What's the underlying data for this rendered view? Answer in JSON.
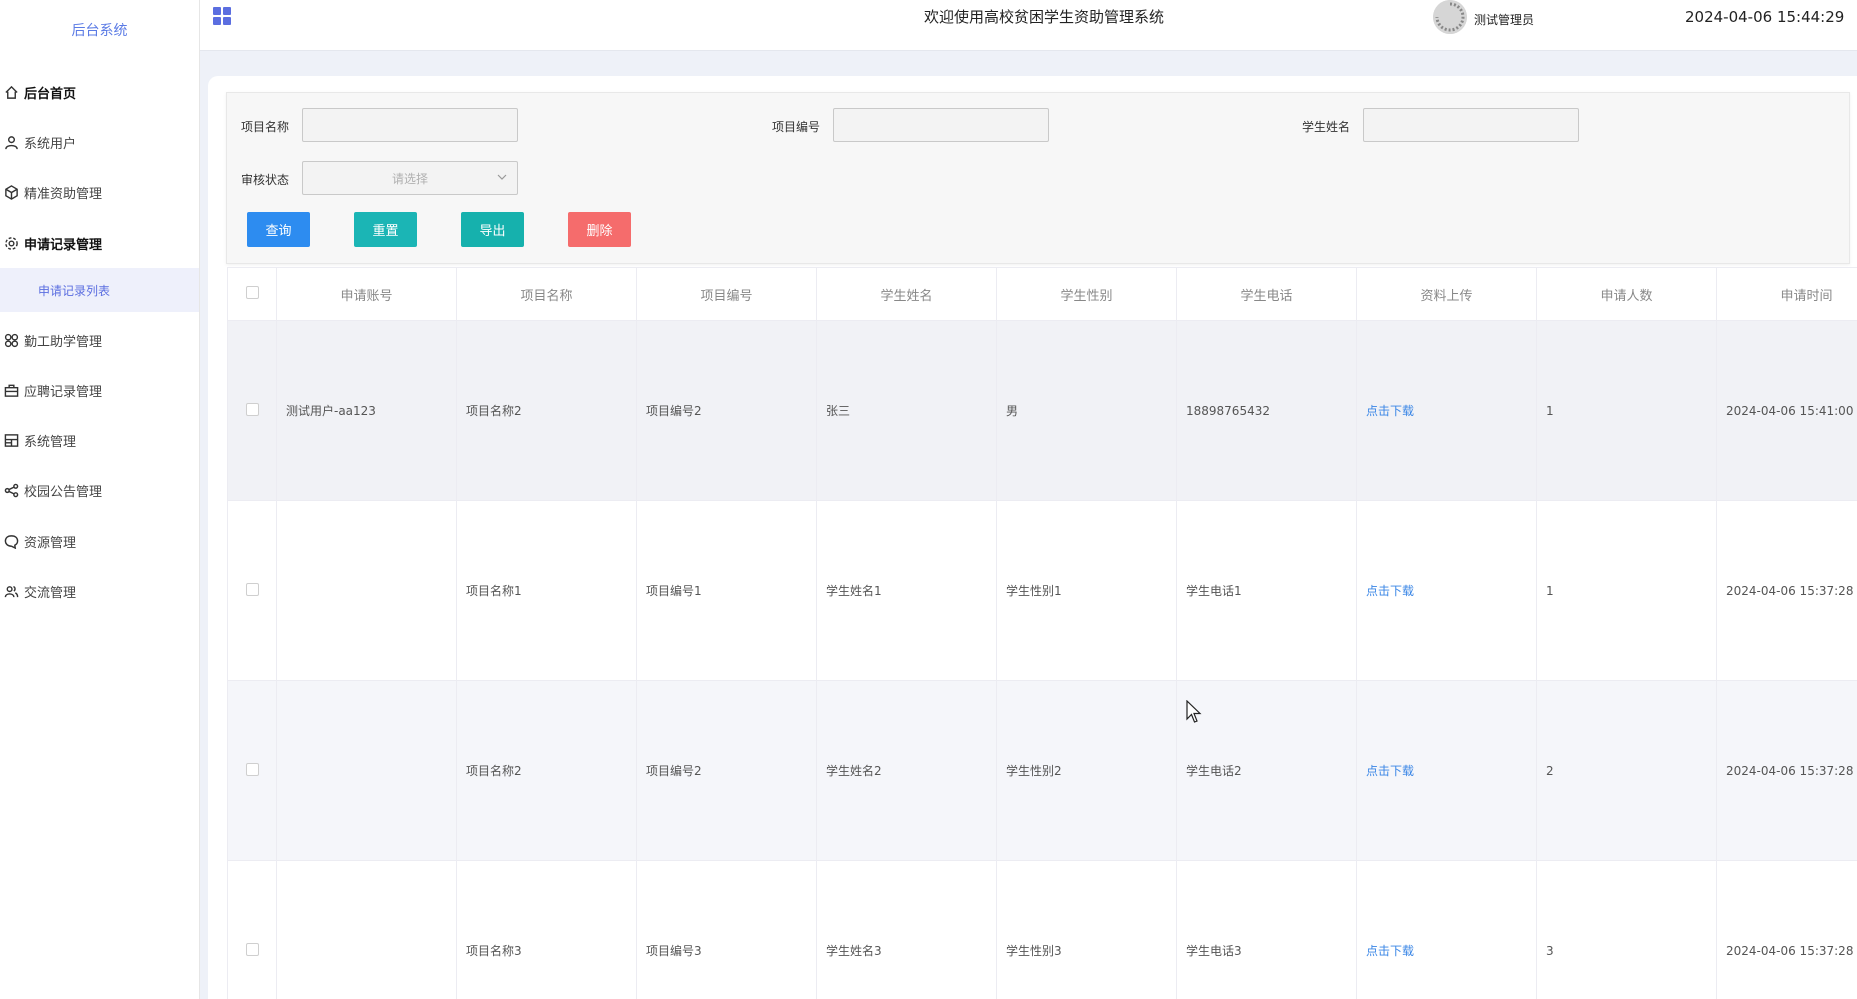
{
  "sidebar": {
    "brand": "后台系统",
    "items": [
      {
        "label": "后台首页",
        "icon": "home-icon"
      },
      {
        "label": "系统用户",
        "icon": "user-icon"
      },
      {
        "label": "精准资助管理",
        "icon": "cube-icon"
      },
      {
        "label": "申请记录管理",
        "icon": "gear-icon"
      },
      {
        "label": "勤工助学管理",
        "icon": "grid-icon"
      },
      {
        "label": "应聘记录管理",
        "icon": "briefcase-icon"
      },
      {
        "label": "系统管理",
        "icon": "layout-icon"
      },
      {
        "label": "校园公告管理",
        "icon": "share-icon"
      },
      {
        "label": "资源管理",
        "icon": "chat-icon"
      },
      {
        "label": "交流管理",
        "icon": "users-icon"
      }
    ],
    "subitem": "申请记录列表"
  },
  "header": {
    "title": "欢迎使用高校贫困学生资助管理系统",
    "user": "测试管理员",
    "datetime": "2024-04-06 15:44:29"
  },
  "search": {
    "project_name_label": "项目名称",
    "project_code_label": "项目编号",
    "student_name_label": "学生姓名",
    "status_label": "审核状态",
    "status_placeholder": "请选择",
    "query_button": "查询",
    "reset_button": "重置",
    "export_button": "导出",
    "delete_button": "删除"
  },
  "colors": {
    "query": "#2d8cf0",
    "reset": "#1bb5b5",
    "export": "#16b1ad",
    "delete": "#f56c6c",
    "link": "#3a86e6"
  },
  "table": {
    "columns": [
      "申请账号",
      "项目名称",
      "项目编号",
      "学生姓名",
      "学生性别",
      "学生电话",
      "资料上传",
      "申请人数",
      "申请时间"
    ],
    "rows": [
      {
        "account": "测试用户-aa123",
        "project_name": "项目名称2",
        "project_code": "项目编号2",
        "student_name": "张三",
        "gender": "男",
        "phone": "18898765432",
        "upload": "点击下载",
        "count": "1",
        "time": "2024-04-06 15:41:00"
      },
      {
        "account": "",
        "project_name": "项目名称1",
        "project_code": "项目编号1",
        "student_name": "学生姓名1",
        "gender": "学生性别1",
        "phone": "学生电话1",
        "upload": "点击下载",
        "count": "1",
        "time": "2024-04-06 15:37:28"
      },
      {
        "account": "",
        "project_name": "项目名称2",
        "project_code": "项目编号2",
        "student_name": "学生姓名2",
        "gender": "学生性别2",
        "phone": "学生电话2",
        "upload": "点击下载",
        "count": "2",
        "time": "2024-04-06 15:37:28"
      },
      {
        "account": "",
        "project_name": "项目名称3",
        "project_code": "项目编号3",
        "student_name": "学生姓名3",
        "gender": "学生性别3",
        "phone": "学生电话3",
        "upload": "点击下载",
        "count": "3",
        "time": "2024-04-06 15:37:28"
      }
    ]
  }
}
